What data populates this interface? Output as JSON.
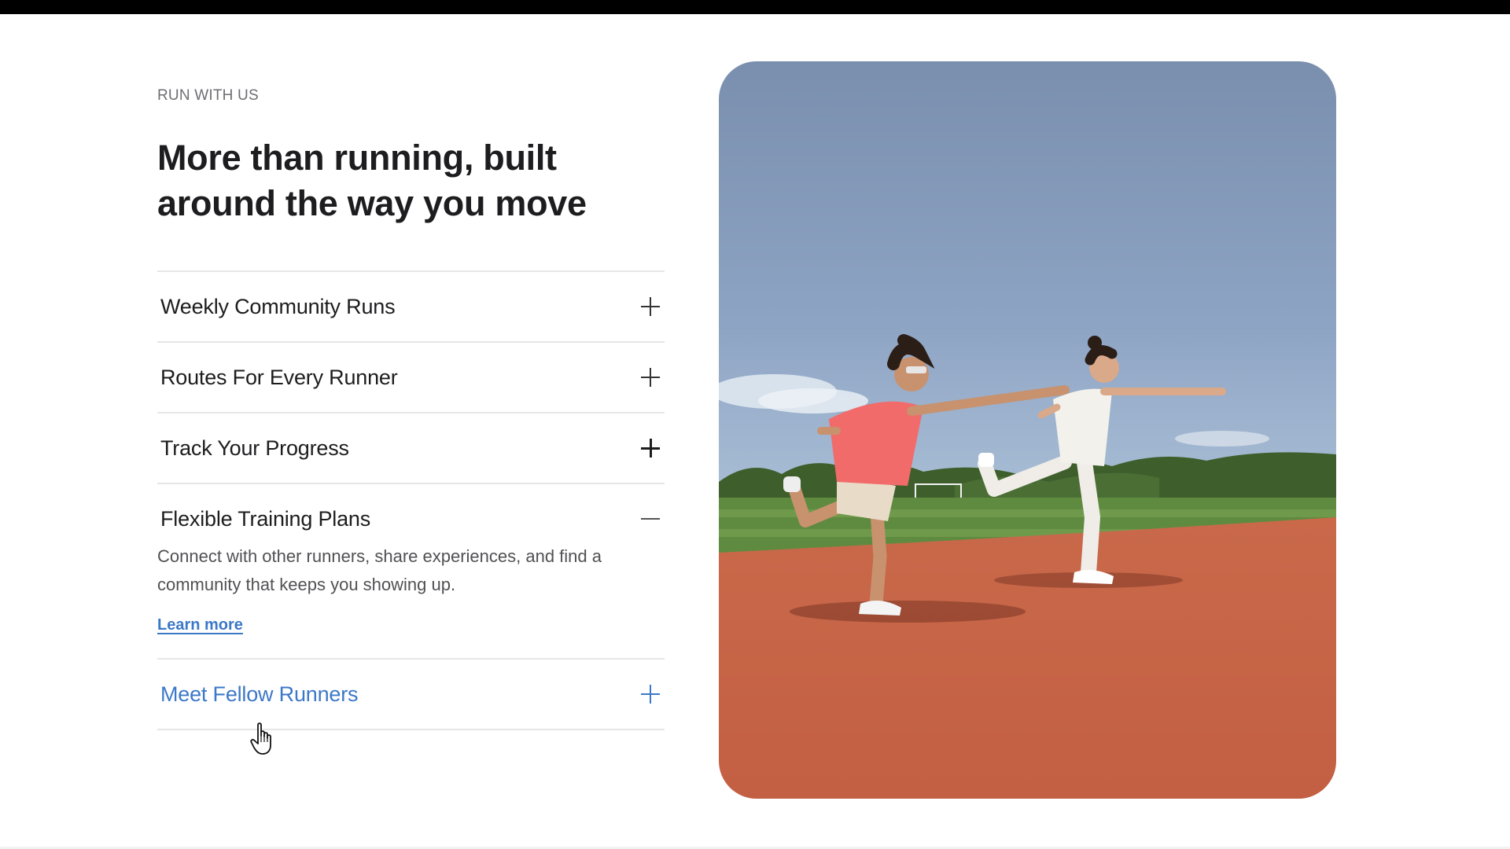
{
  "section": {
    "eyebrow": "RUN WITH US",
    "headline": "More than running, built around the way you move"
  },
  "accordion": {
    "items": [
      {
        "title": "Weekly Community Runs",
        "state": "collapsed",
        "icon": "plus-icon"
      },
      {
        "title": "Routes For Every Runner",
        "state": "collapsed",
        "icon": "plus-icon"
      },
      {
        "title": "Track Your Progress",
        "state": "collapsed",
        "icon": "plus-icon"
      },
      {
        "title": "Flexible Training Plans",
        "state": "expanded",
        "icon": "minus-icon",
        "body": "Connect with other runners, share experiences, and find a community that keeps you showing up.",
        "link": "Learn more"
      },
      {
        "title": "Meet Fellow Runners",
        "state": "collapsed-hover",
        "icon": "plus-icon"
      }
    ]
  },
  "photo": {
    "description_icon": "runners-photo",
    "colors": {
      "sky": "#7d93b3",
      "field": "#5e8a3e",
      "track": "#c8674a"
    }
  },
  "colors": {
    "accent": "#3c78c8",
    "text": "#1d1d1f",
    "muted": "#6e6e73",
    "divider": "#e6e6e6"
  }
}
